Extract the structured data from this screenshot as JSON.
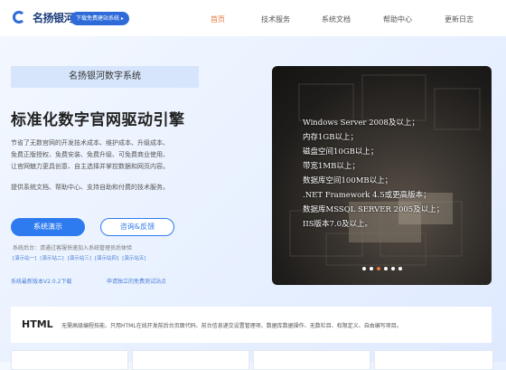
{
  "header": {
    "logo_text": "名扬银河",
    "download_button": "下载免费建站系统 ▸",
    "nav": [
      "首页",
      "技术服务",
      "系统文档",
      "帮助中心",
      "更新日志"
    ],
    "nav_active": 0
  },
  "hero_left": {
    "subtitle": "名扬银河数字系统",
    "headline": "标准化数字官网驱动引擎",
    "description": [
      "节省了无数官网的开发技术成本、维护成本、升级成本、",
      "免费正版授权、免费安装、免费升级、可免费商业使用、",
      "让官网魅力更具创意、自主选择并掌控数据和网页内容。"
    ],
    "description2": "提供系统文档、帮助中心、支持自助和付费的技术服务。",
    "primary_button": "系统演示",
    "secondary_button": "咨询&反馈",
    "account_note": "系统后台：请通过客服快速加入系统管理员后体验",
    "links": [
      "[演示站一]",
      "[演示站二]",
      "[演示站三]",
      "[演示站四]",
      "[演示站五]"
    ],
    "version": "系统最新版本V2.0.2下载",
    "apply": "申请独立的免费测试站点"
  },
  "hero_image": {
    "lines": [
      "Windows Server 2008及以上；",
      "内存1GB以上；",
      "磁盘空间10GB以上；",
      "带宽1MB以上；",
      "数据库空间100MB以上；",
      ".NET Framework 4.5或更高版本；",
      "数据库MSSQL SERVER 2005及以上；",
      "IIS版本7.0及以上。"
    ],
    "dot_count": 6,
    "active_dot": 2
  },
  "html_card": {
    "title": "HTML",
    "text": "无需高级编程技能、只用HTML在线开发前后台页面代码、前台信息递交设置管理项、数据库数据操作、无数栏目、权限定义、自由编写项目。"
  },
  "colors": {
    "primary": "#2e7bf0",
    "accent": "#e8743b",
    "logo_blue": "#2e6bd8"
  }
}
